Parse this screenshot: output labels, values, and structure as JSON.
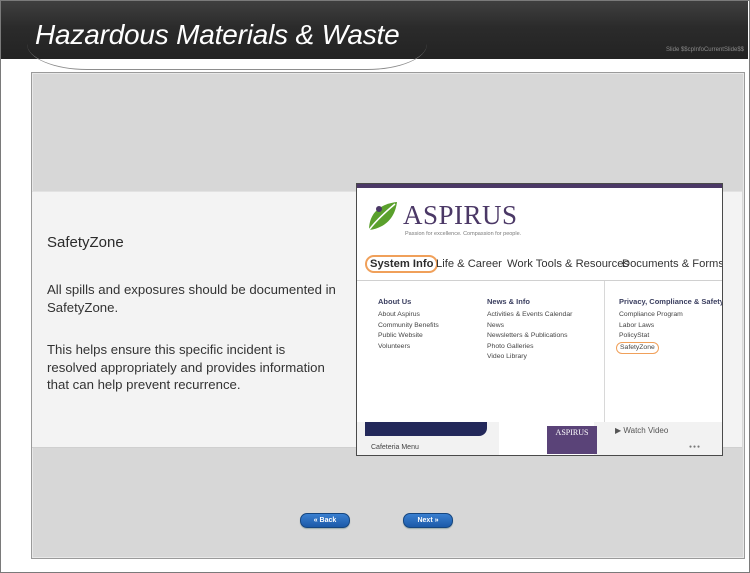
{
  "header": {
    "title": "Hazardous Materials & Waste",
    "slide_info": "Slide $$cpInfoCurrentSlide$$"
  },
  "content": {
    "heading": "SafetyZone",
    "paragraph1": "All spills and exposures should be documented in SafetyZone.",
    "paragraph2": "This helps ensure this specific incident is resolved appropriately and provides information that can help prevent recurrence."
  },
  "screenshot": {
    "logo_text": "ASPIRUS",
    "logo_tagline": "Passion for excellence. Compassion for people.",
    "nav_tabs": [
      "System Info",
      "Life & Career",
      "Work Tools & Resources",
      "Documents & Forms"
    ],
    "columns": [
      {
        "heading": "About Us",
        "items": [
          "About Aspirus",
          "Community Benefits",
          "Public Website",
          "Volunteers"
        ]
      },
      {
        "heading": "News & Info",
        "items": [
          "Activities & Events Calendar",
          "News",
          "Newsletters & Publications",
          "Photo Galleries",
          "Video Library"
        ]
      },
      {
        "heading": "Privacy, Compliance & Safety",
        "items": [
          "Compliance Program",
          "Labor Laws",
          "PolicyStat",
          "SafetyZone"
        ]
      }
    ],
    "bottom": {
      "cafeteria": "Cafeteria Menu",
      "tile_logo": "ASPIRUS",
      "watch": "Watch Video"
    }
  },
  "buttons": {
    "back": "« Back",
    "next": "Next »"
  },
  "colors": {
    "header_bg": "#2b2b2b",
    "accent_purple": "#4b3866",
    "highlight_orange": "#f0a05a",
    "button_blue": "#1b5aa8"
  }
}
